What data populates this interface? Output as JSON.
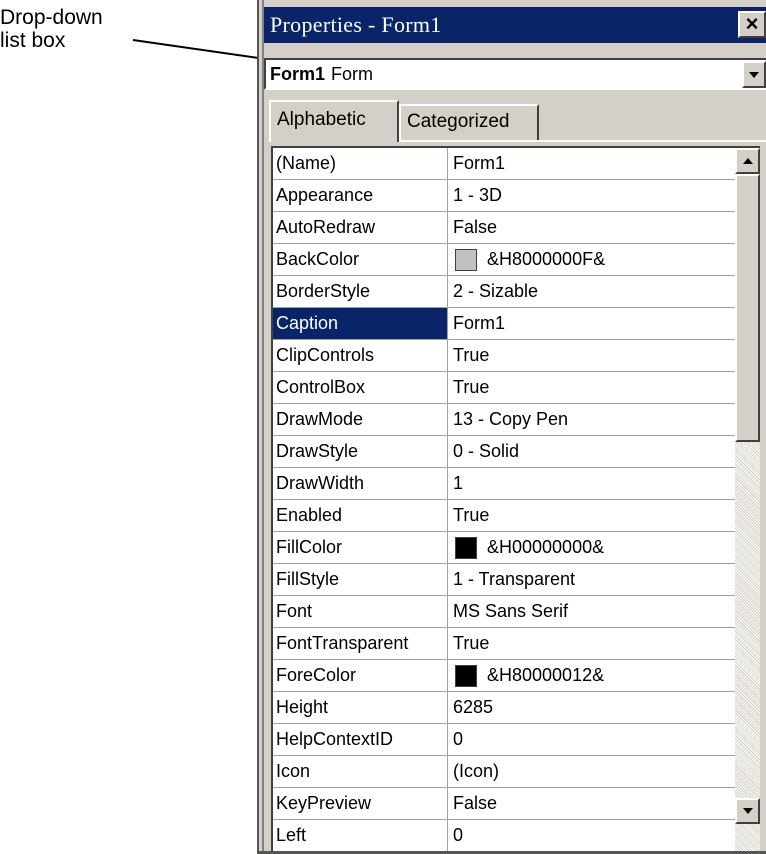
{
  "annotation": {
    "label": "Drop-down\nlist box"
  },
  "window": {
    "title": "Properties - Form1",
    "close_label": "×"
  },
  "object_combo": {
    "name": "Form1",
    "type": "Form"
  },
  "tabs": [
    {
      "label": "Alphabetic",
      "active": true
    },
    {
      "label": "Categorized",
      "active": false
    }
  ],
  "properties": [
    {
      "name": "(Name)",
      "value": "Form1"
    },
    {
      "name": "Appearance",
      "value": "1 - 3D"
    },
    {
      "name": "AutoRedraw",
      "value": "False"
    },
    {
      "name": "BackColor",
      "value": "&H8000000F&",
      "swatch": "#c0c0c0"
    },
    {
      "name": "BorderStyle",
      "value": "2 - Sizable"
    },
    {
      "name": "Caption",
      "value": "Form1",
      "selected": true
    },
    {
      "name": "ClipControls",
      "value": "True"
    },
    {
      "name": "ControlBox",
      "value": "True"
    },
    {
      "name": "DrawMode",
      "value": "13 - Copy Pen"
    },
    {
      "name": "DrawStyle",
      "value": "0 - Solid"
    },
    {
      "name": "DrawWidth",
      "value": "1"
    },
    {
      "name": "Enabled",
      "value": "True"
    },
    {
      "name": "FillColor",
      "value": "&H00000000&",
      "swatch": "#000000"
    },
    {
      "name": "FillStyle",
      "value": "1 - Transparent"
    },
    {
      "name": "Font",
      "value": "MS Sans Serif"
    },
    {
      "name": "FontTransparent",
      "value": "True"
    },
    {
      "name": "ForeColor",
      "value": "&H80000012&",
      "swatch": "#000000"
    },
    {
      "name": "Height",
      "value": "6285"
    },
    {
      "name": "HelpContextID",
      "value": "0"
    },
    {
      "name": "Icon",
      "value": "(Icon)"
    },
    {
      "name": "KeyPreview",
      "value": "False"
    },
    {
      "name": "Left",
      "value": "0"
    }
  ],
  "colors": {
    "title_bar": "#0a246a",
    "selection": "#0a246a",
    "face": "#d4d0c8"
  }
}
